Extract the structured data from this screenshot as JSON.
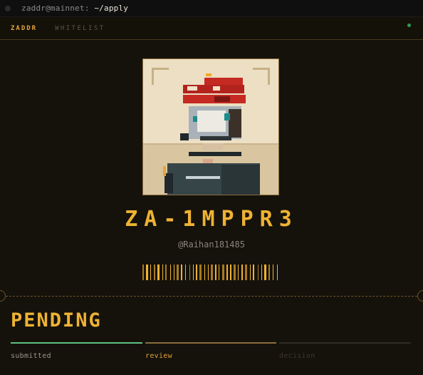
{
  "terminal": {
    "user_host": "zaddr@mainnet:",
    "path": "~/apply"
  },
  "nav": {
    "brand": "ZADDR",
    "link": "WHITELIST"
  },
  "profile": {
    "token_id": "ZA-1MPPR3",
    "handle": "@Raihan181485"
  },
  "status": "PENDING",
  "steps": [
    {
      "label": "submitted",
      "state": "done",
      "color": "#5fbf80"
    },
    {
      "label": "review",
      "state": "active",
      "color": "#8c6e3e"
    },
    {
      "label": "decision",
      "state": "upcoming",
      "color": "#2f2b23"
    }
  ],
  "colors": {
    "accent": "#efb233",
    "brand": "#e0a43a",
    "done": "#5fbf80",
    "live": "#2e9a54"
  }
}
